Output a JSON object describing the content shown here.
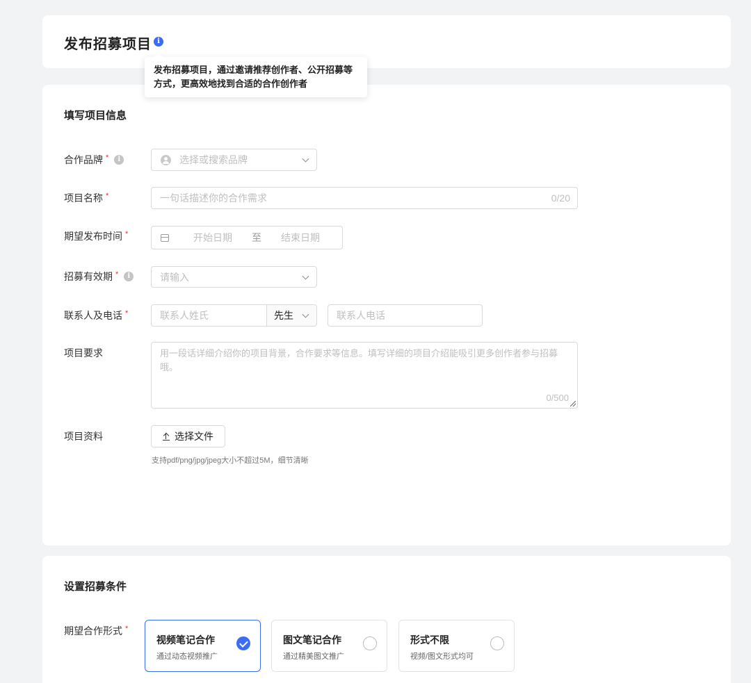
{
  "header": {
    "title": "发布招募项目",
    "info_icon": "info-icon",
    "tooltip": "发布招募项目，通过邀请推荐创作者、公开招募等方式，更高效地找到合适的合作创作者"
  },
  "info_section": {
    "title": "填写项目信息",
    "brand": {
      "label": "合作品牌",
      "required": "*",
      "placeholder": "选择或搜索品牌"
    },
    "project_name": {
      "label": "项目名称",
      "required": "*",
      "placeholder": "一句话描述你的合作需求",
      "count": "0/20"
    },
    "publish_time": {
      "label": "期望发布时间",
      "required": "*",
      "start_placeholder": "开始日期",
      "separator": "至",
      "end_placeholder": "结束日期"
    },
    "validity": {
      "label": "招募有效期",
      "required": "*",
      "placeholder": "请输入"
    },
    "contact": {
      "label": "联系人及电话",
      "required": "*",
      "name_placeholder": "联系人姓氏",
      "salutation": "先生",
      "phone_placeholder": "联系人电话"
    },
    "requirements": {
      "label": "项目要求",
      "placeholder": "用一段话详细介绍你的项目背景，合作要求等信息。填写详细的项目介绍能吸引更多创作者参与招募哦。",
      "count": "0/500"
    },
    "materials": {
      "label": "项目资料",
      "button_label": "选择文件",
      "hint": "支持pdf/png/jpg/jpeg大小不超过5M，细节清晰"
    }
  },
  "conditions_section": {
    "title": "设置招募条件",
    "form": {
      "label": "期望合作形式",
      "required": "*",
      "options": [
        {
          "title": "视频笔记合作",
          "desc": "通过动态视频推广",
          "selected": true
        },
        {
          "title": "图文笔记合作",
          "desc": "通过精美图文推广",
          "selected": false
        },
        {
          "title": "形式不限",
          "desc": "视频/图文形式均可",
          "selected": false
        }
      ]
    }
  },
  "colors": {
    "accent": "#3b6cf6",
    "required": "#f5222d",
    "background": "#f2f3f5"
  }
}
